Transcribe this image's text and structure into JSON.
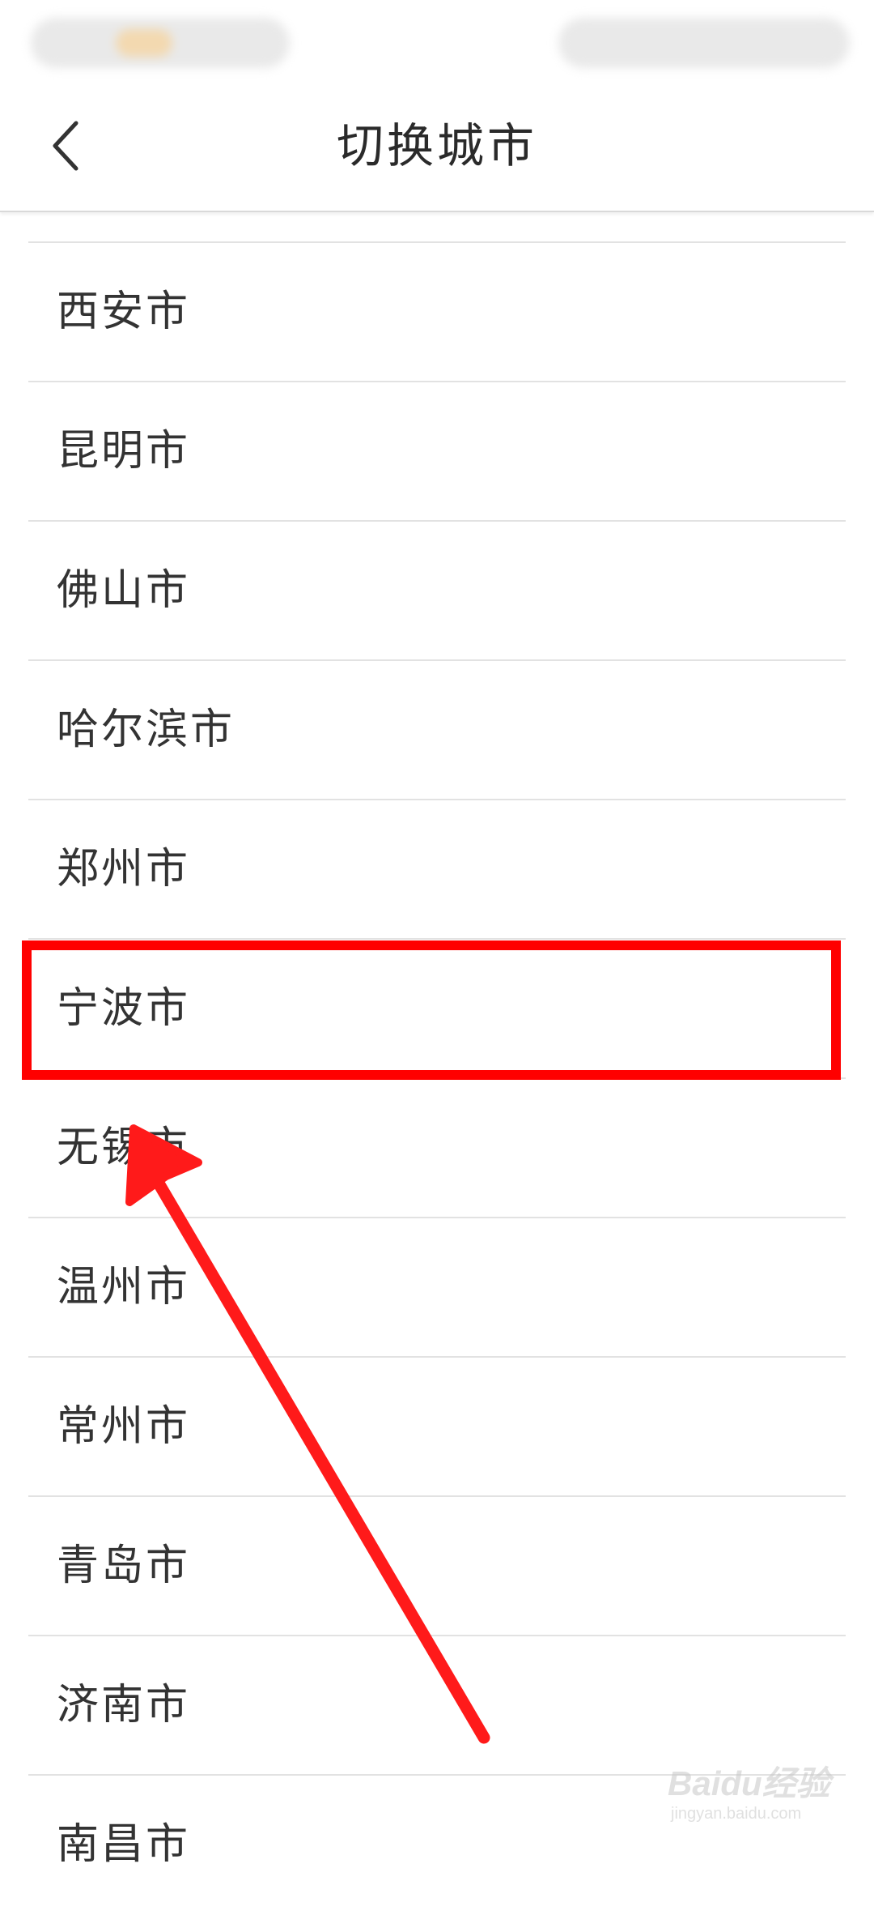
{
  "header": {
    "title": "切换城市",
    "back_icon": "chevron-left-icon"
  },
  "cities": [
    {
      "name": "西安市"
    },
    {
      "name": "昆明市"
    },
    {
      "name": "佛山市"
    },
    {
      "name": "哈尔滨市"
    },
    {
      "name": "郑州市"
    },
    {
      "name": "宁波市"
    },
    {
      "name": "无锡市"
    },
    {
      "name": "温州市"
    },
    {
      "name": "常州市"
    },
    {
      "name": "青岛市"
    },
    {
      "name": "济南市"
    },
    {
      "name": "南昌市"
    }
  ],
  "annotation": {
    "highlighted_city": "宁波市",
    "highlight_color": "#ff0000",
    "arrow_color": "#ff1a1a"
  },
  "watermark": {
    "main": "Baidu经验",
    "sub": "jingyan.baidu.com"
  }
}
